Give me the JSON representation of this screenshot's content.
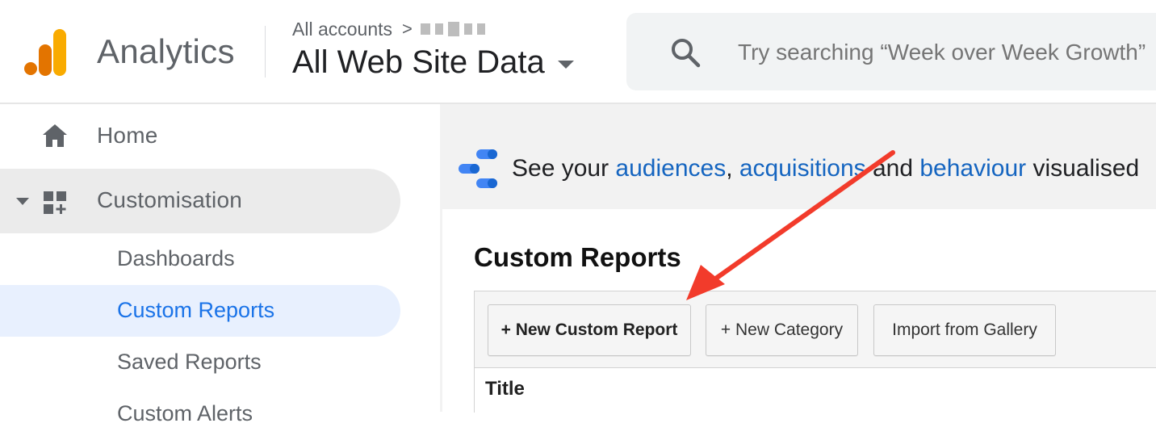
{
  "header": {
    "app_name": "Analytics",
    "breadcrumb": {
      "root": "All accounts",
      "separator": ">"
    },
    "property": "All Web Site Data",
    "search": {
      "placeholder": "Try searching “Week over Week Growth”"
    }
  },
  "sidebar": {
    "home": {
      "label": "Home",
      "icon": "home-icon"
    },
    "customisation": {
      "label": "Customisation",
      "icon": "dashboard-add-icon",
      "expanded": true,
      "items": [
        {
          "label": "Dashboards",
          "selected": false
        },
        {
          "label": "Custom Reports",
          "selected": true
        },
        {
          "label": "Saved Reports",
          "selected": false
        },
        {
          "label": "Custom Alerts",
          "selected": false
        }
      ]
    }
  },
  "banner": {
    "prefix": "See your ",
    "link_audiences": "audiences",
    "comma": ", ",
    "link_acquisitions": "acquisitions",
    "and": " and ",
    "link_behaviour": "behaviour",
    "suffix": " visualised"
  },
  "main": {
    "title": "Custom Reports",
    "buttons": {
      "new_custom_report": "+ New Custom Report",
      "new_category": "+ New Category",
      "import_from_gallery": "Import from Gallery"
    },
    "table": {
      "columns": [
        "Title"
      ]
    }
  },
  "colors": {
    "brand_orange": "#f9ab00",
    "brand_dark_orange": "#e37400",
    "link_blue": "#1565c0",
    "selected_blue": "#1a73e8",
    "annotation_red": "#f23b2b"
  }
}
